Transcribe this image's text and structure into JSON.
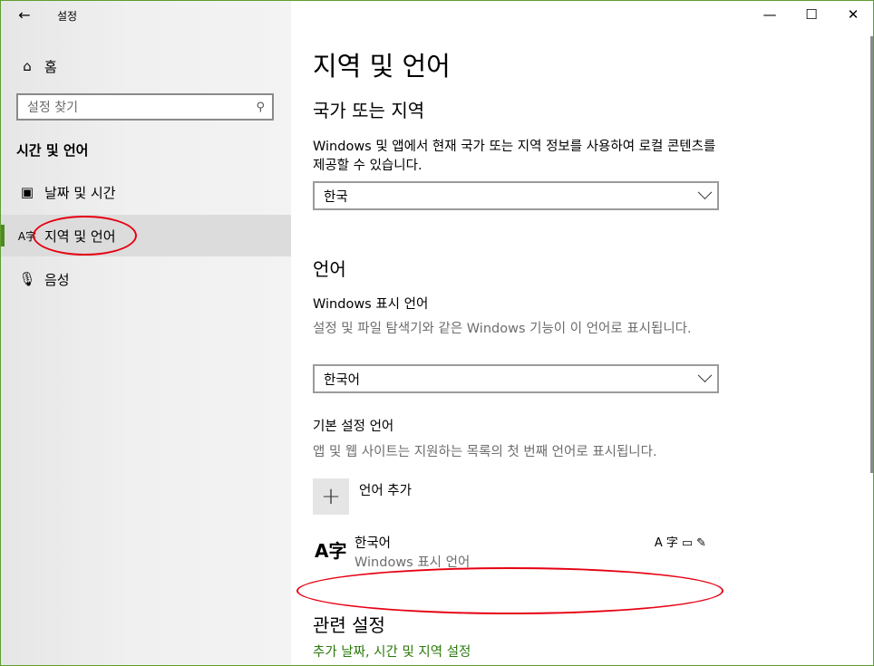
{
  "window": {
    "title": "설정",
    "back_icon": "←",
    "minimize": "—",
    "maximize": "☐",
    "close": "✕"
  },
  "sidebar": {
    "home_label": "홈",
    "search_placeholder": "설정 찾기",
    "section_title": "시간 및 언어",
    "items": [
      {
        "label": "날짜 및 시간",
        "icon": "calendar-clock-icon"
      },
      {
        "label": "지역 및 언어",
        "icon": "language-icon",
        "active": true
      },
      {
        "label": "음성",
        "icon": "microphone-icon"
      }
    ]
  },
  "main": {
    "page_title": "지역 및 언어",
    "region": {
      "heading": "국가 또는 지역",
      "description": "Windows 및 앱에서 현재 국가 또는 지역 정보를 사용하여 로컬 콘텐츠를 제공할 수 있습니다.",
      "selected": "한국"
    },
    "language": {
      "heading": "언어",
      "display_label": "Windows 표시 언어",
      "display_description": "설정 및 파일 탐색기와 같은 Windows 기능이 이 언어로 표시됩니다.",
      "display_selected": "한국어",
      "preferred_label": "기본 설정 언어",
      "preferred_description": "앱 및 웹 사이트는 지원하는 목록의 첫 번째 언어로 표시됩니다.",
      "add_label": "언어 추가",
      "installed": [
        {
          "name": "한국어",
          "sub": "Windows 표시 언어",
          "glyph": "A字"
        }
      ]
    },
    "related": {
      "heading": "관련 설정",
      "link": "추가 날짜, 시간 및 지역 설정"
    }
  },
  "colors": {
    "accent": "#4e8a20",
    "link": "#2b7a0b",
    "annotation": "#e60012"
  }
}
